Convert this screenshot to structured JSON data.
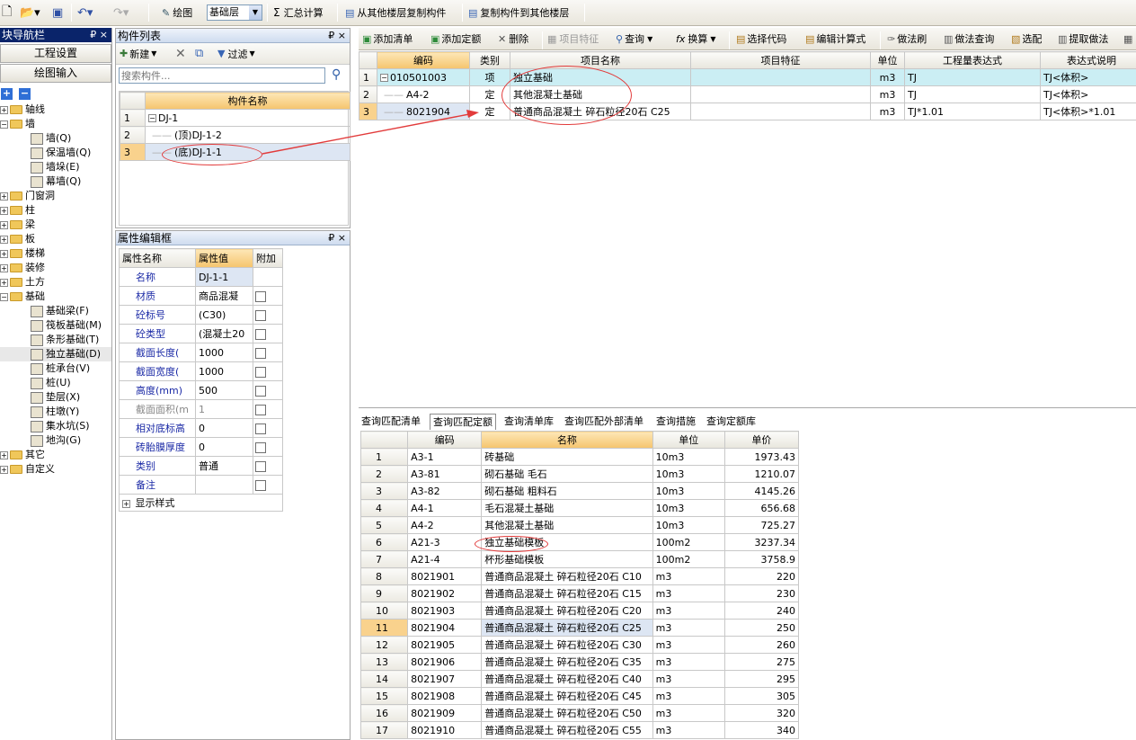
{
  "toolbar": {
    "draw_label": "绘图",
    "layer": "基础层",
    "sum_label": "汇总计算",
    "copy_from_label": "从其他楼层复制构件",
    "copy_to_label": "复制构件到其他楼层"
  },
  "nav": {
    "title": "块导航栏",
    "pin": "₽ ×",
    "btn_settings": "工程设置",
    "btn_draw": "绘图输入",
    "plus": "+",
    "minus": "−",
    "items": [
      {
        "label": "轴线",
        "exp": "+"
      },
      {
        "label": "墙",
        "exp": "−"
      },
      {
        "label": "墙(Q)"
      },
      {
        "label": "保温墙(Q)"
      },
      {
        "label": "墙垛(E)"
      },
      {
        "label": "幕墙(Q)"
      },
      {
        "label": "门窗洞",
        "exp": "+"
      },
      {
        "label": "柱",
        "exp": "+"
      },
      {
        "label": "梁",
        "exp": "+"
      },
      {
        "label": "板",
        "exp": "+"
      },
      {
        "label": "楼梯",
        "exp": "+"
      },
      {
        "label": "装修",
        "exp": "+"
      },
      {
        "label": "土方",
        "exp": "+"
      },
      {
        "label": "基础",
        "exp": "−"
      },
      {
        "label": "基础梁(F)"
      },
      {
        "label": "筏板基础(M)"
      },
      {
        "label": "条形基础(T)"
      },
      {
        "label": "独立基础(D)"
      },
      {
        "label": "桩承台(V)"
      },
      {
        "label": "桩(U)"
      },
      {
        "label": "垫层(X)"
      },
      {
        "label": "柱墩(Y)"
      },
      {
        "label": "集水坑(S)"
      },
      {
        "label": "地沟(G)"
      },
      {
        "label": "其它",
        "exp": "+"
      },
      {
        "label": "自定义",
        "exp": "+"
      }
    ]
  },
  "component_list": {
    "title": "构件列表",
    "pin": "₽ ×",
    "new_label": "新建",
    "filter_label": "过滤",
    "search_placeholder": "搜索构件...",
    "col_name": "构件名称",
    "rows": [
      {
        "num": "1",
        "exp": "−",
        "name": "DJ-1"
      },
      {
        "num": "2",
        "name": "(顶)DJ-1-2"
      },
      {
        "num": "3",
        "name": "(底)DJ-1-1"
      }
    ]
  },
  "props": {
    "title": "属性编辑框",
    "pin": "₽ ×",
    "col_name": "属性名称",
    "col_value": "属性值",
    "col_extra": "附加",
    "rows": [
      {
        "name": "名称",
        "value": "DJ-1-1",
        "chk": false,
        "gray": false
      },
      {
        "name": "材质",
        "value": "商品混凝",
        "chk": true,
        "gray": false
      },
      {
        "name": "砼标号",
        "value": "(C30)",
        "chk": true,
        "gray": false
      },
      {
        "name": "砼类型",
        "value": "(混凝土20",
        "chk": true,
        "gray": false
      },
      {
        "name": "截面长度(",
        "value": "1000",
        "chk": true,
        "gray": false
      },
      {
        "name": "截面宽度(",
        "value": "1000",
        "chk": true,
        "gray": false
      },
      {
        "name": "高度(mm)",
        "value": "500",
        "chk": true,
        "gray": false
      },
      {
        "name": "截面面积(m",
        "value": "1",
        "chk": true,
        "gray": true
      },
      {
        "name": "相对底标高",
        "value": "0",
        "chk": true,
        "gray": false
      },
      {
        "name": "砖胎膜厚度",
        "value": "0",
        "chk": true,
        "gray": false
      },
      {
        "name": "类别",
        "value": "普通",
        "chk": true,
        "gray": false
      },
      {
        "name": "备注",
        "value": "",
        "chk": true,
        "gray": false
      }
    ],
    "show_style": "显示样式",
    "show_style_exp": "+"
  },
  "list_toolbar": {
    "add_list": "添加清单",
    "add_quota": "添加定额",
    "delete": "删除",
    "item_feature": "项目特征",
    "query": "查询",
    "convert": "换算",
    "choose_code": "选择代码",
    "edit_formula": "编辑计算式",
    "method_brush": "做法刷",
    "method_query": "做法查询",
    "pick": "选配",
    "extract": "提取做法"
  },
  "list_grid": {
    "headers": [
      "编码",
      "类别",
      "项目名称",
      "项目特征",
      "单位",
      "工程量表达式",
      "表达式说明"
    ],
    "rows": [
      {
        "num": "1",
        "exp": "−",
        "code": "010501003",
        "type": "项",
        "name": "独立基础",
        "feature": "",
        "unit": "m3",
        "expr": "TJ",
        "desc": "TJ<体积>"
      },
      {
        "num": "2",
        "code": "A4-2",
        "type": "定",
        "name": "其他混凝土基础",
        "feature": "",
        "unit": "m3",
        "expr": "TJ",
        "desc": "TJ<体积>"
      },
      {
        "num": "3",
        "code": "8021904",
        "type": "定",
        "name": "普通商品混凝土 碎石粒径20石 C25",
        "feature": "",
        "unit": "m3",
        "expr": "TJ*1.01",
        "desc": "TJ<体积>*1.01"
      }
    ]
  },
  "bottom_tabs": [
    "查询匹配清单",
    "查询匹配定额",
    "查询清单库",
    "查询匹配外部清单",
    "查询措施",
    "查询定额库"
  ],
  "quota_grid": {
    "headers": [
      "编码",
      "名称",
      "单位",
      "单价"
    ],
    "rows": [
      {
        "num": "1",
        "code": "A3-1",
        "name": "砖基础",
        "unit": "10m3",
        "price": "1973.43"
      },
      {
        "num": "2",
        "code": "A3-81",
        "name": "砌石基础 毛石",
        "unit": "10m3",
        "price": "1210.07"
      },
      {
        "num": "3",
        "code": "A3-82",
        "name": "砌石基础 粗料石",
        "unit": "10m3",
        "price": "4145.26"
      },
      {
        "num": "4",
        "code": "A4-1",
        "name": "毛石混凝土基础",
        "unit": "10m3",
        "price": "656.68"
      },
      {
        "num": "5",
        "code": "A4-2",
        "name": "其他混凝土基础",
        "unit": "10m3",
        "price": "725.27"
      },
      {
        "num": "6",
        "code": "A21-3",
        "name": "独立基础模板",
        "unit": "100m2",
        "price": "3237.34"
      },
      {
        "num": "7",
        "code": "A21-4",
        "name": "杯形基础模板",
        "unit": "100m2",
        "price": "3758.9"
      },
      {
        "num": "8",
        "code": "8021901",
        "name": "普通商品混凝土 碎石粒径20石 C10",
        "unit": "m3",
        "price": "220"
      },
      {
        "num": "9",
        "code": "8021902",
        "name": "普通商品混凝土 碎石粒径20石 C15",
        "unit": "m3",
        "price": "230"
      },
      {
        "num": "10",
        "code": "8021903",
        "name": "普通商品混凝土 碎石粒径20石 C20",
        "unit": "m3",
        "price": "240"
      },
      {
        "num": "11",
        "code": "8021904",
        "name": "普通商品混凝土 碎石粒径20石 C25",
        "unit": "m3",
        "price": "250"
      },
      {
        "num": "12",
        "code": "8021905",
        "name": "普通商品混凝土 碎石粒径20石 C30",
        "unit": "m3",
        "price": "260"
      },
      {
        "num": "13",
        "code": "8021906",
        "name": "普通商品混凝土 碎石粒径20石 C35",
        "unit": "m3",
        "price": "275"
      },
      {
        "num": "14",
        "code": "8021907",
        "name": "普通商品混凝土 碎石粒径20石 C40",
        "unit": "m3",
        "price": "295"
      },
      {
        "num": "15",
        "code": "8021908",
        "name": "普通商品混凝土 碎石粒径20石 C45",
        "unit": "m3",
        "price": "305"
      },
      {
        "num": "16",
        "code": "8021909",
        "name": "普通商品混凝土 碎石粒径20石 C50",
        "unit": "m3",
        "price": "320"
      },
      {
        "num": "17",
        "code": "8021910",
        "name": "普通商品混凝土 碎石粒径20石 C55",
        "unit": "m3",
        "price": "340"
      }
    ]
  }
}
